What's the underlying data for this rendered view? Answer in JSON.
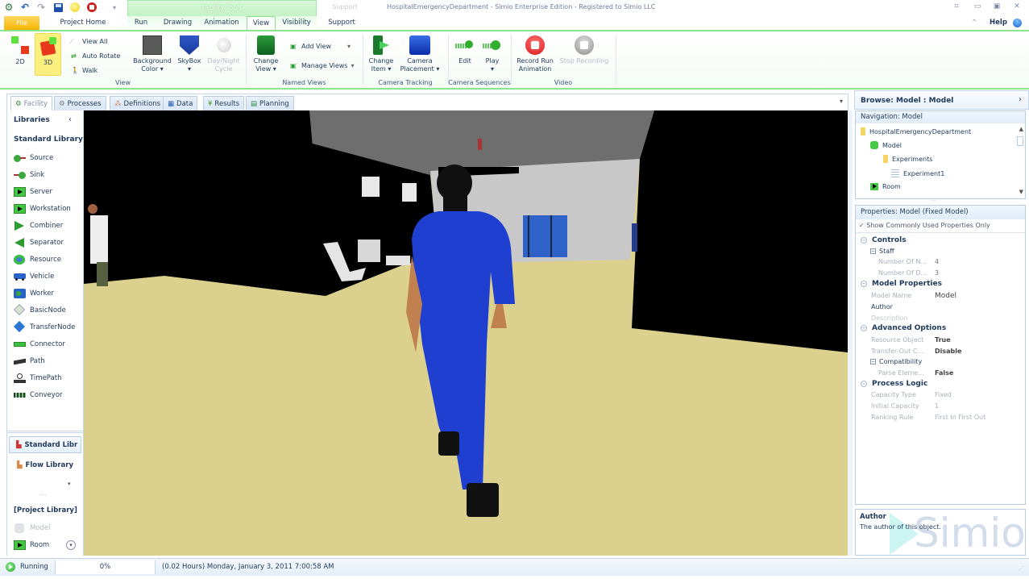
{
  "window": {
    "title": "HospitalEmergencyDepartment - Simio Enterprise Edition - Registered to Simio LLC",
    "context_tab_group": "Facility Tools",
    "context_tab_group_2": "Support",
    "help_label": "Help"
  },
  "quick_access": [
    "app-logo-icon",
    "undo-icon",
    "redo-icon",
    "save-icon",
    "run-icon",
    "stop-icon",
    "customize-qat-icon"
  ],
  "ribbon_tabs": [
    {
      "label": "File"
    },
    {
      "label": "Project Home"
    },
    {
      "label": "Run"
    },
    {
      "label": "Drawing"
    },
    {
      "label": "Animation"
    },
    {
      "label": "View",
      "active": true
    },
    {
      "label": "Visibility"
    },
    {
      "label": "Support"
    }
  ],
  "ribbon": {
    "view_group": {
      "label": "View",
      "btn_2d": "2D",
      "btn_3d": "3D",
      "view_all": "View All",
      "auto_rotate": "Auto Rotate",
      "walk": "Walk",
      "background_color": "Background Color",
      "skybox": "SkyBox",
      "day_night": "Day/Night Cycle"
    },
    "named_views": {
      "label": "Named Views",
      "change_view": "Change View",
      "add_view": "Add View",
      "manage_views": "Manage Views"
    },
    "camera_tracking": {
      "label": "Camera Tracking",
      "change_item": "Change Item",
      "camera_placement": "Camera Placement"
    },
    "camera_sequences": {
      "label": "Camera Sequences",
      "edit": "Edit",
      "play": "Play"
    },
    "video": {
      "label": "Video",
      "record": "Record Run Animation",
      "stop": "Stop Recording"
    }
  },
  "doc_tabs": [
    {
      "label": "Facility",
      "active": true
    },
    {
      "label": "Processes"
    },
    {
      "label": "Definitions"
    },
    {
      "label": "Data"
    },
    {
      "label": "Results"
    },
    {
      "label": "Planning"
    }
  ],
  "libraries": {
    "header": "Libraries",
    "standard_title": "Standard Library",
    "items": [
      "Source",
      "Sink",
      "Server",
      "Workstation",
      "Combiner",
      "Separator",
      "Resource",
      "Vehicle",
      "Worker",
      "BasicNode",
      "TransferNode",
      "Connector",
      "Path",
      "TimePath",
      "Conveyor"
    ],
    "lib_buttons": [
      "Standard Libr",
      "Flow Library"
    ],
    "project_library": "[Project Library]",
    "project_items": [
      "Model",
      "Room"
    ]
  },
  "browse": {
    "title": "Browse: Model : Model",
    "nav_label": "Navigation: Model",
    "tree": [
      {
        "label": "HospitalEmergencyDepartment",
        "level": 0,
        "icon": "folder-icon"
      },
      {
        "label": "Model",
        "level": 1,
        "icon": "model-cube-icon"
      },
      {
        "label": "Experiments",
        "level": 2,
        "icon": "folder-icon"
      },
      {
        "label": "Experiment1",
        "level": 3,
        "icon": "experiment-icon"
      },
      {
        "label": "Room",
        "level": 1,
        "icon": "server-icon"
      }
    ]
  },
  "properties": {
    "title": "Properties: Model (Fixed Model)",
    "show_common": "Show Commonly Used Properties Only",
    "controls": "Controls",
    "staff": "Staff",
    "rows_staff": [
      {
        "name": "Number Of N...",
        "value": "4"
      },
      {
        "name": "Number Of D...",
        "value": "3"
      }
    ],
    "model_props": "Model Properties",
    "model_name_label": "Model Name",
    "model_name_value": "Model",
    "author_label": "Author",
    "description_label": "Description",
    "advanced": "Advanced Options",
    "rows_adv": [
      {
        "name": "Resource Object",
        "value": "True"
      },
      {
        "name": "Transfer-Out C...",
        "value": "Disable"
      }
    ],
    "compat": "Compatibility",
    "parse_name": "Parse Eleme...",
    "parse_value": "False",
    "process_logic": "Process Logic",
    "rows_logic": [
      {
        "name": "Capacity Type",
        "value": "Fixed"
      },
      {
        "name": "Initial Capacity",
        "value": "1"
      },
      {
        "name": "Ranking Rule",
        "value": "First In First Out"
      }
    ]
  },
  "help_box": {
    "title": "Author",
    "text": "The author of this object.",
    "watermark": "Simio"
  },
  "status": {
    "state": "Running",
    "progress": "0%",
    "time": "(0.02 Hours) Monday, January 3, 2011 7:00:58 AM"
  },
  "colors": {
    "accent_green": "#8fe38f",
    "file_tab": "#f7b500",
    "text_primary": "#1e395b",
    "floor": "#dcd08f",
    "scrub_blue": "#1f3fd0"
  }
}
